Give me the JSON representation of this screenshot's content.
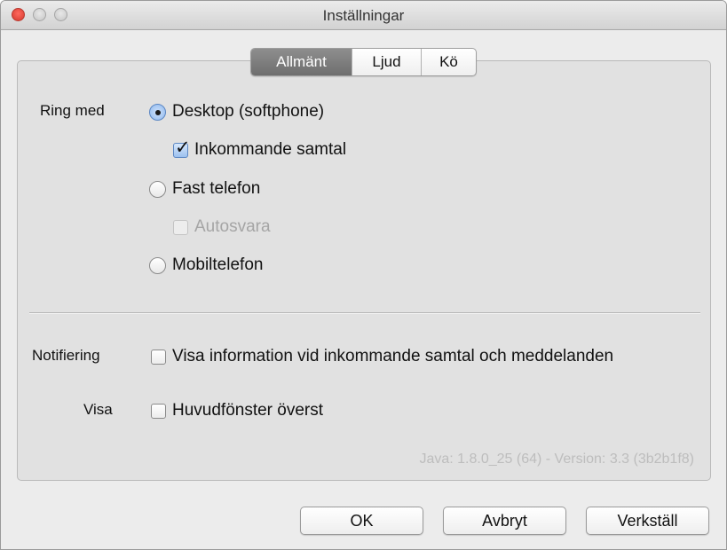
{
  "window": {
    "title": "Inställningar"
  },
  "tabs": [
    {
      "label": "Allmänt",
      "active": true
    },
    {
      "label": "Ljud",
      "active": false
    },
    {
      "label": "Kö",
      "active": false
    }
  ],
  "call_with": {
    "label": "Ring med",
    "options": [
      {
        "label": "Desktop (softphone)",
        "selected": true
      },
      {
        "label": "Fast telefon",
        "selected": false
      },
      {
        "label": "Mobiltelefon",
        "selected": false
      }
    ],
    "incoming_calls": {
      "label": "Inkommande samtal",
      "checked": true
    },
    "autoanswer": {
      "label": "Autosvara",
      "checked": false,
      "enabled": false
    }
  },
  "notification": {
    "label": "Notifiering",
    "option": {
      "label": "Visa information vid inkommande samtal och meddelanden",
      "checked": false
    }
  },
  "view": {
    "label": "Visa",
    "option": {
      "label": "Huvudfönster överst",
      "checked": false
    }
  },
  "version_text": "Java: 1.8.0_25 (64) - Version: 3.3 (3b2b1f8)",
  "buttons": {
    "ok": "OK",
    "cancel": "Avbryt",
    "apply": "Verkställ"
  },
  "colors": {
    "accent": "#5b86c3",
    "active_tab": "#7a7a7a",
    "close_button": "#e8473c"
  }
}
